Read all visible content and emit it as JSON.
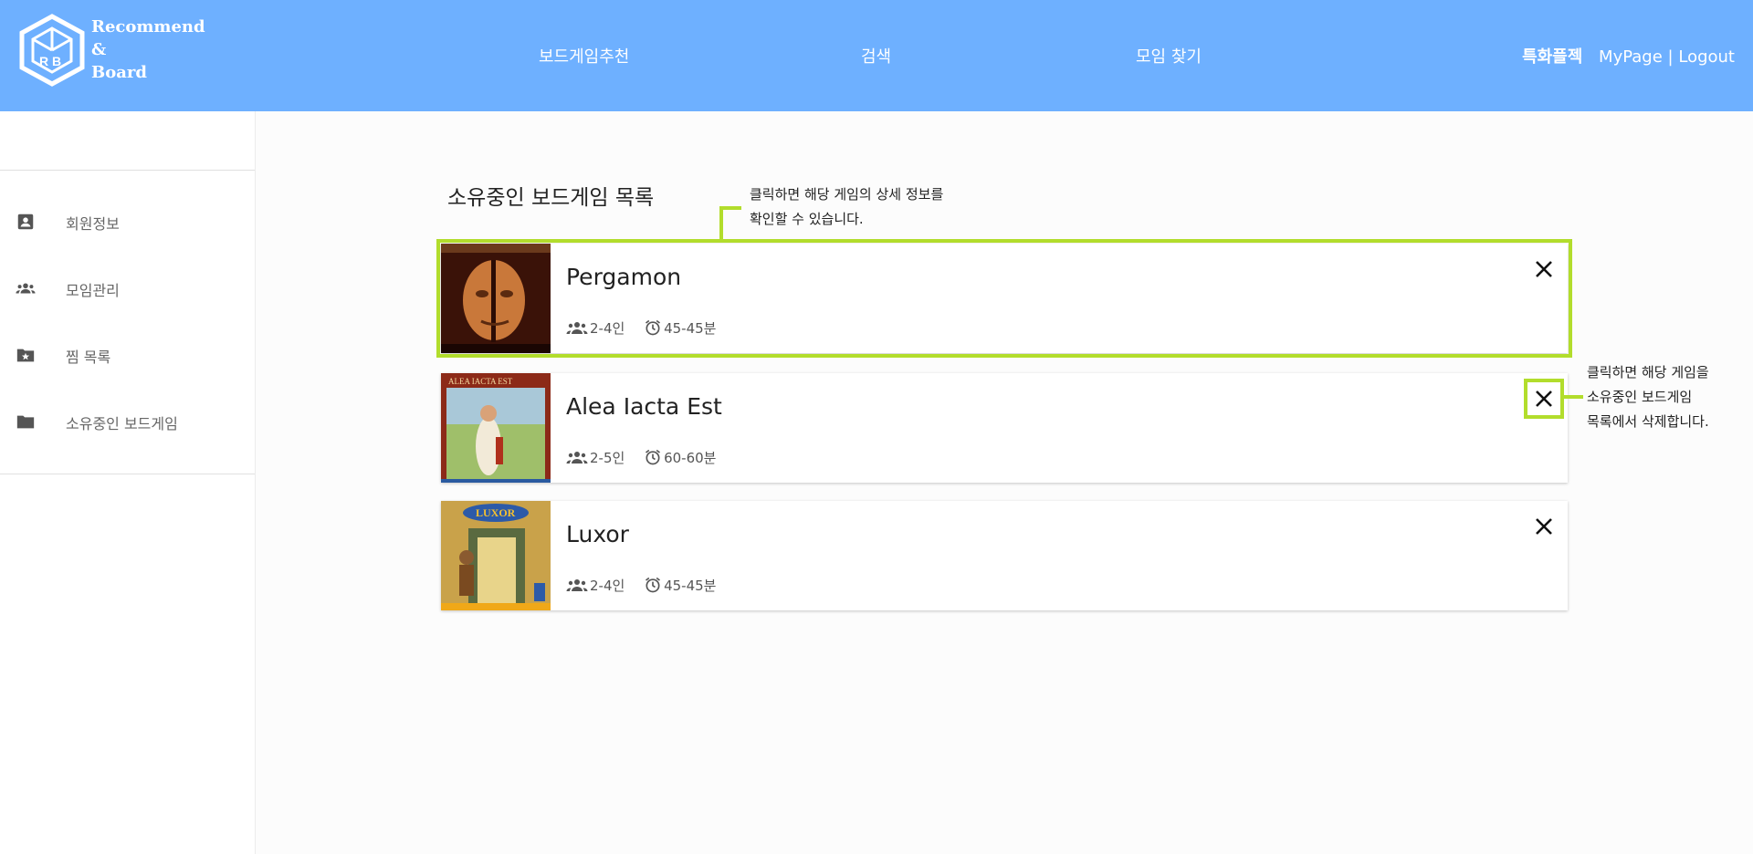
{
  "header": {
    "logo_text": [
      "Recommend",
      "&",
      "Board"
    ],
    "logo_letters": "R B",
    "nav": [
      "보드게임추천",
      "검색",
      "모임 찾기"
    ],
    "special_label": "특화플젝",
    "mypage_label": "MyPage",
    "separator": "|",
    "logout_label": "Logout"
  },
  "sidebar": {
    "items": [
      {
        "label": "회원정보",
        "icon": "account-box-icon"
      },
      {
        "label": "모임관리",
        "icon": "groups-icon"
      },
      {
        "label": "찜 목록",
        "icon": "folder-star-icon"
      },
      {
        "label": "소유중인 보드게임",
        "icon": "folder-icon"
      }
    ]
  },
  "main": {
    "title": "소유중인 보드게임 목록",
    "games": [
      {
        "name": "Pergamon",
        "players": "2-4인",
        "time": "45-45분",
        "highlighted": true
      },
      {
        "name": "Alea Iacta Est",
        "players": "2-5인",
        "time": "60-60분",
        "highlighted": false
      },
      {
        "name": "Luxor",
        "players": "2-4인",
        "time": "45-45분",
        "highlighted": false
      }
    ]
  },
  "annotations": {
    "card_hint": [
      "클릭하면 해당 게임의 상세 정보를",
      "확인할 수 있습니다."
    ],
    "delete_hint": [
      "클릭하면 해당 게임을",
      "소유중인 보드게임",
      "목록에서 삭제합니다."
    ]
  },
  "colors": {
    "header_bg": "#6eb0ff",
    "highlight": "#b2dd2c",
    "page_bg": "#fcfcfc"
  }
}
